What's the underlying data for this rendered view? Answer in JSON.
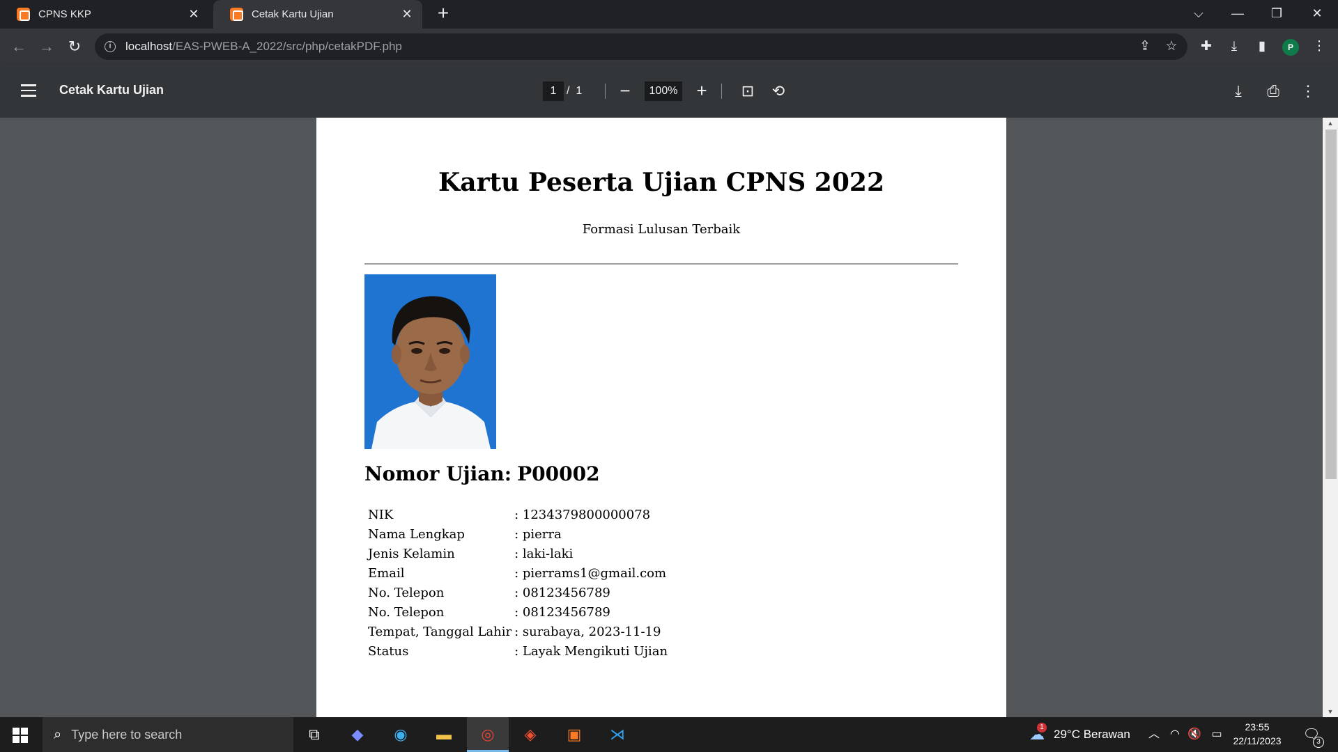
{
  "browser": {
    "tabs": [
      {
        "title": "CPNS KKP",
        "active": false
      },
      {
        "title": "Cetak Kartu Ujian",
        "active": true
      }
    ],
    "address": {
      "host": "localhost",
      "path": "/EAS-PWEB-A_2022/src/php/cetakPDF.php"
    },
    "profile_initial": "P"
  },
  "pdf_viewer": {
    "title": "Cetak Kartu Ujian",
    "current_page": "1",
    "page_separator": "/",
    "total_pages": "1",
    "zoom": "100%"
  },
  "document": {
    "title": "Kartu Peserta Ujian CPNS 2022",
    "subtitle": "Formasi Lulusan Terbaik",
    "exam_number_label": "Nomor Ujian:",
    "exam_number": "P00002",
    "fields": [
      {
        "label": "NIK",
        "value": ": 1234379800000078"
      },
      {
        "label": "Nama Lengkap",
        "value": ": pierra"
      },
      {
        "label": "Jenis Kelamin",
        "value": ": laki-laki"
      },
      {
        "label": "Email",
        "value": ": pierrams1@gmail.com"
      },
      {
        "label": "No. Telepon",
        "value": ": 08123456789"
      },
      {
        "label": "No. Telepon",
        "value": ": 08123456789"
      },
      {
        "label": "Tempat, Tanggal Lahir",
        "value": ": surabaya, 2023-11-19"
      },
      {
        "label": "Status",
        "value": ": Layak Mengikuti Ujian"
      }
    ]
  },
  "taskbar": {
    "search_placeholder": "Type here to search",
    "weather": "29°C  Berawan",
    "weather_badge": "1",
    "time": "23:55",
    "date": "22/11/2023",
    "notification_count": "3"
  },
  "colors": {
    "chrome_dark": "#202124",
    "chrome_toolbar": "#35363a",
    "pdf_toolbar": "#323639",
    "pdf_background": "#525659",
    "xampp_orange": "#fb7a24",
    "photo_background": "#1f74d1"
  }
}
